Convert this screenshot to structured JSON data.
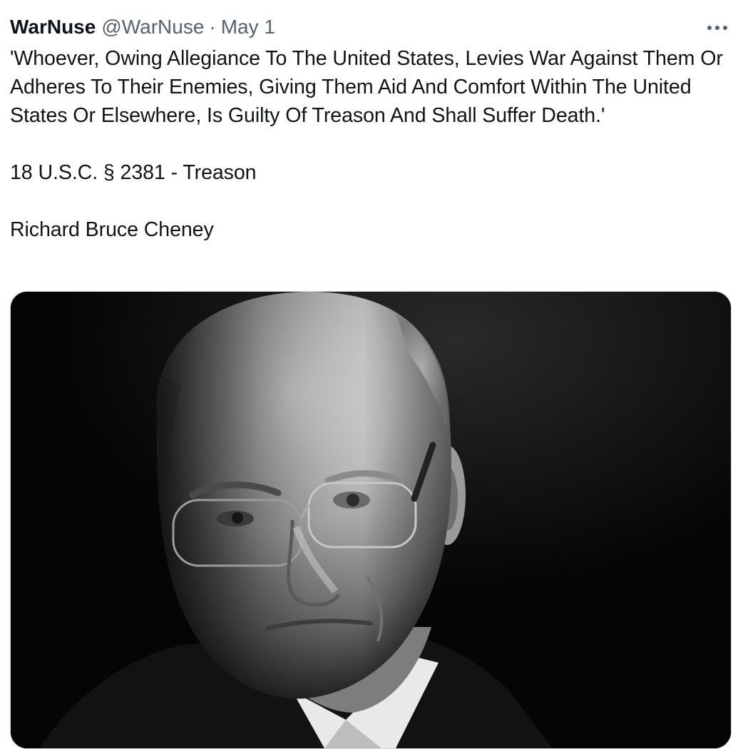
{
  "tweet": {
    "author": {
      "display_name": "WarNuse",
      "handle": "@WarNuse"
    },
    "separator": "·",
    "timestamp": "May 1",
    "more_icon": "more-horizontal-icon",
    "text": {
      "quote": "'Whoever, Owing Allegiance To The United States, Levies War Against Them Or Adheres To Their Enemies, Giving Them Aid And Comfort Within The United States Or Elsewhere, Is Guilty Of Treason And Shall Suffer Death.'",
      "citation": "18 U.S.C. § 2381 - Treason",
      "name": "Richard Bruce Cheney"
    },
    "media": {
      "type": "photo",
      "style": "black-and-white portrait of a bald older man wearing rimless glasses"
    }
  },
  "colors": {
    "text_primary": "#0f1419",
    "text_secondary": "#536471",
    "border": "#cfd9de",
    "media_background": "#050505"
  }
}
